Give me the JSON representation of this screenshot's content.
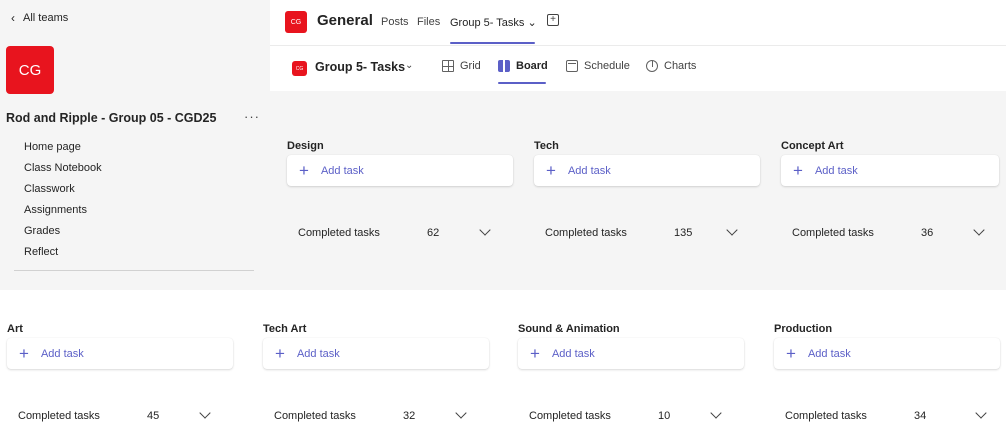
{
  "sidebar": {
    "back_label": "All teams",
    "team_avatar": "CG",
    "team_name": "Rod and Ripple - Group 05 - CGD25",
    "more": "···",
    "items": [
      {
        "label": "Home page"
      },
      {
        "label": "Class Notebook"
      },
      {
        "label": "Classwork"
      },
      {
        "label": "Assignments"
      },
      {
        "label": "Grades"
      },
      {
        "label": "Reflect"
      }
    ]
  },
  "channel": {
    "avatar": "CG",
    "title": "General",
    "tabs": [
      {
        "label": "Posts"
      },
      {
        "label": "Files"
      },
      {
        "label": "Group 5- Tasks ⌄"
      }
    ],
    "add_tab": "+"
  },
  "planner": {
    "icon": "CG",
    "title": "Group 5- Tasks",
    "caret": "⌄",
    "views": [
      {
        "label": "Grid",
        "icon": "grid-icon"
      },
      {
        "label": "Board",
        "icon": "board-icon"
      },
      {
        "label": "Schedule",
        "icon": "schedule-icon"
      },
      {
        "label": "Charts",
        "icon": "charts-icon"
      }
    ],
    "active_view": "Board"
  },
  "board": {
    "add_task_label": "Add task",
    "add_task_plus": "+",
    "completed_label": "Completed tasks",
    "buckets": [
      {
        "title": "Design",
        "completed": "62"
      },
      {
        "title": "Tech",
        "completed": "135"
      },
      {
        "title": "Concept Art",
        "completed": "36"
      },
      {
        "title": "Art",
        "completed": "45"
      },
      {
        "title": "Tech Art",
        "completed": "32"
      },
      {
        "title": "Sound & Animation",
        "completed": "10"
      },
      {
        "title": "Production",
        "completed": "34"
      }
    ]
  },
  "colors": {
    "brand": "#e8141e",
    "accent": "#5b5fc7",
    "background": "#f5f5f5"
  }
}
